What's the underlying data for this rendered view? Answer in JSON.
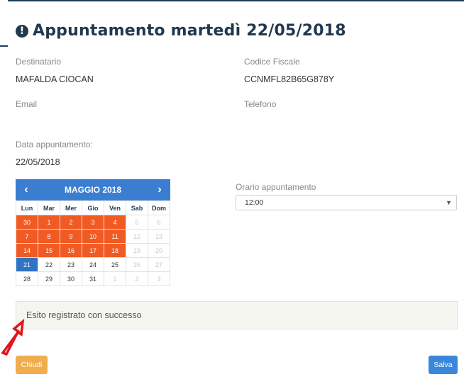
{
  "modal": {
    "title": "Appuntamento martedì 22/05/2018",
    "info_icon": "!"
  },
  "fields": {
    "recipient_label": "Destinatario",
    "recipient_value": "MAFALDA CIOCAN",
    "tax_code_label": "Codice Fiscale",
    "tax_code_value": "CCNMFL82B65G878Y",
    "email_label": "Email",
    "phone_label": "Telefono",
    "date_label": "Data appuntamento:",
    "date_value": "22/05/2018"
  },
  "calendar": {
    "month_label": "MAGGIO 2018",
    "prev": "‹",
    "next": "›",
    "weekdays": [
      "Lun",
      "Mar",
      "Mer",
      "Gio",
      "Ven",
      "Sab",
      "Dom"
    ],
    "weeks": [
      [
        {
          "d": "30",
          "s": "hl"
        },
        {
          "d": "1",
          "s": "hl"
        },
        {
          "d": "2",
          "s": "hl"
        },
        {
          "d": "3",
          "s": "hl"
        },
        {
          "d": "4",
          "s": "hl"
        },
        {
          "d": "5",
          "s": "dim"
        },
        {
          "d": "6",
          "s": "dim"
        }
      ],
      [
        {
          "d": "7",
          "s": "hl"
        },
        {
          "d": "8",
          "s": "hl"
        },
        {
          "d": "9",
          "s": "hl"
        },
        {
          "d": "10",
          "s": "hl"
        },
        {
          "d": "11",
          "s": "hl"
        },
        {
          "d": "12",
          "s": "dim"
        },
        {
          "d": "13",
          "s": "dim"
        }
      ],
      [
        {
          "d": "14",
          "s": "hl"
        },
        {
          "d": "15",
          "s": "hl"
        },
        {
          "d": "16",
          "s": "hl"
        },
        {
          "d": "17",
          "s": "hl"
        },
        {
          "d": "18",
          "s": "hl"
        },
        {
          "d": "19",
          "s": "dim"
        },
        {
          "d": "20",
          "s": "dim"
        }
      ],
      [
        {
          "d": "21",
          "s": "sel"
        },
        {
          "d": "22",
          "s": "norm"
        },
        {
          "d": "23",
          "s": "norm"
        },
        {
          "d": "24",
          "s": "norm"
        },
        {
          "d": "25",
          "s": "norm"
        },
        {
          "d": "26",
          "s": "dim"
        },
        {
          "d": "27",
          "s": "dim"
        }
      ],
      [
        {
          "d": "28",
          "s": "norm"
        },
        {
          "d": "29",
          "s": "norm"
        },
        {
          "d": "30",
          "s": "norm"
        },
        {
          "d": "31",
          "s": "norm"
        },
        {
          "d": "1",
          "s": "dim"
        },
        {
          "d": "2",
          "s": "dim"
        },
        {
          "d": "3",
          "s": "dim"
        }
      ]
    ],
    "colors": {
      "header": "#3b7ed1",
      "highlight": "#f15a22",
      "selected": "#2f73c4"
    }
  },
  "time": {
    "label": "Orario appuntamento",
    "value": "12:00"
  },
  "alert": {
    "message": "Esito registrato con successo"
  },
  "buttons": {
    "close": "Chiudi",
    "save": "Salva"
  }
}
